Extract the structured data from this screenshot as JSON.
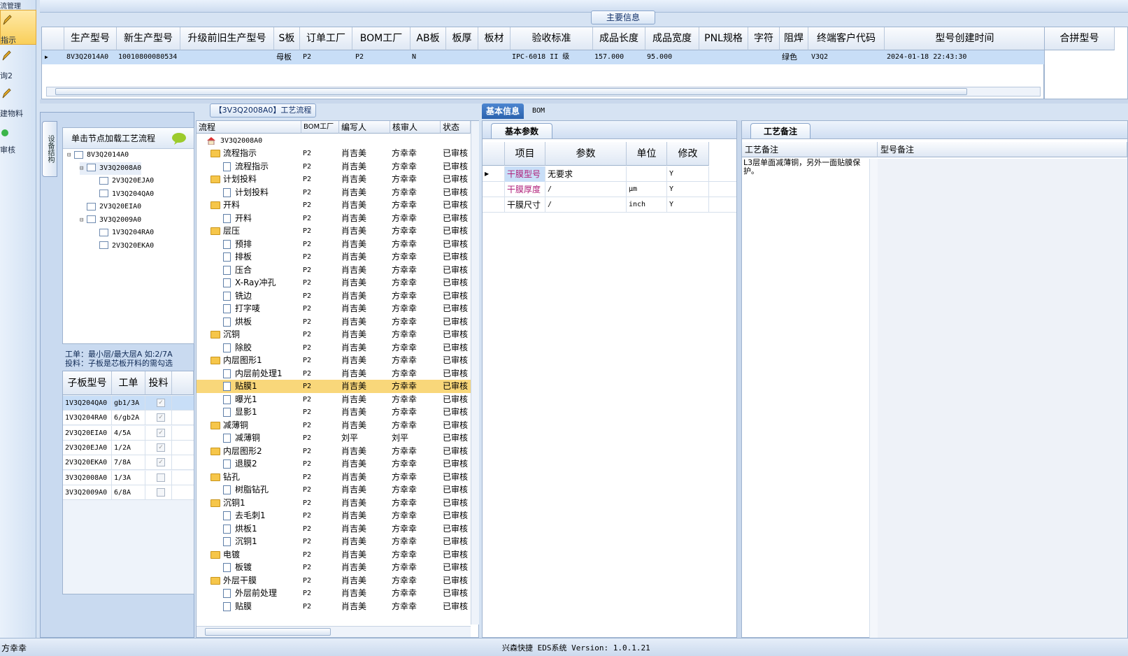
{
  "nav": {
    "items": [
      {
        "label": "指示",
        "active": true
      },
      {
        "label": "询2",
        "active": false
      },
      {
        "label": "建物料",
        "active": false
      },
      {
        "label": "审核",
        "active": false
      }
    ],
    "top_label": "流管理"
  },
  "main_info": {
    "title": "主要信息",
    "columns": [
      "生产型号",
      "新生产型号",
      "升级前旧生产型号",
      "S板",
      "订单工厂",
      "BOM工厂",
      "AB板",
      "板厚",
      "板材",
      "验收标准",
      "成品长度",
      "成品宽度",
      "PNL规格",
      "字符",
      "阻焊",
      "终端客户代码",
      "型号创建时间"
    ],
    "row": {
      "生产型号": "8V3Q2014A0",
      "新生产型号": "10010800080534",
      "升级前旧生产型号": "",
      "S板": "母板",
      "订单工厂": "P2",
      "BOM工厂": "P2",
      "AB板": "N",
      "板厚": "",
      "板材": "",
      "验收标准": "IPC-6018 II 级",
      "成品长度": "157.000",
      "成品宽度": "95.000",
      "PNL规格": "",
      "字符": "",
      "阻焊": "绿色",
      "终端客户代码": "V3Q2",
      "型号创建时间": "2024-01-18 22:43:30"
    },
    "side_header": "合拼型号"
  },
  "structure": {
    "tab_label": "设备结构",
    "hint": "单击节点加载工艺流程",
    "nodes": [
      {
        "id": "8V3Q2014A0",
        "level": 0
      },
      {
        "id": "3V3Q2008A0",
        "level": 1
      },
      {
        "id": "2V3Q20EJA0",
        "level": 2
      },
      {
        "id": "1V3Q204QA0",
        "level": 2
      },
      {
        "id": "2V3Q20EIA0",
        "level": 1
      },
      {
        "id": "3V3Q2009A0",
        "level": 1
      },
      {
        "id": "1V3Q204RA0",
        "level": 2
      },
      {
        "id": "2V3Q20EKA0",
        "level": 2
      }
    ],
    "info_line1": "工单：最小层/最大层A 如:2/7A",
    "info_line2": "投料：子板是芯板开料的需勾选"
  },
  "subboards": {
    "columns": [
      "子板型号",
      "工单",
      "投料"
    ],
    "rows": [
      {
        "model": "1V3Q204QA0",
        "wo": "gb1/3A",
        "checked": true
      },
      {
        "model": "1V3Q204RA0",
        "wo": "6/gb2A",
        "checked": true
      },
      {
        "model": "2V3Q20EIA0",
        "wo": "4/5A",
        "checked": true
      },
      {
        "model": "2V3Q20EJA0",
        "wo": "1/2A",
        "checked": true
      },
      {
        "model": "2V3Q20EKA0",
        "wo": "7/8A",
        "checked": true
      },
      {
        "model": "3V3Q2008A0",
        "wo": "1/3A",
        "checked": false
      },
      {
        "model": "3V3Q2009A0",
        "wo": "6/8A",
        "checked": false
      }
    ]
  },
  "process": {
    "title": "【3V3Q2008A0】工艺流程",
    "columns": [
      "流程",
      "BOM工厂",
      "编写人",
      "核审人",
      "状态"
    ],
    "root": "3V3Q2008A0",
    "rows": [
      {
        "name": "流程指示",
        "type": "folder",
        "bom": "P2",
        "writer": "肖吉美",
        "reviewer": "方幸幸",
        "status": "已审核"
      },
      {
        "name": "流程指示",
        "type": "doc",
        "bom": "P2",
        "writer": "肖吉美",
        "reviewer": "方幸幸",
        "status": "已审核"
      },
      {
        "name": "计划投料",
        "type": "folder",
        "bom": "P2",
        "writer": "肖吉美",
        "reviewer": "方幸幸",
        "status": "已审核"
      },
      {
        "name": "计划投料",
        "type": "doc",
        "bom": "P2",
        "writer": "肖吉美",
        "reviewer": "方幸幸",
        "status": "已审核"
      },
      {
        "name": "开料",
        "type": "folder",
        "bom": "P2",
        "writer": "肖吉美",
        "reviewer": "方幸幸",
        "status": "已审核"
      },
      {
        "name": "开料",
        "type": "doc",
        "bom": "P2",
        "writer": "肖吉美",
        "reviewer": "方幸幸",
        "status": "已审核"
      },
      {
        "name": "层压",
        "type": "folder",
        "bom": "P2",
        "writer": "肖吉美",
        "reviewer": "方幸幸",
        "status": "已审核"
      },
      {
        "name": "预排",
        "type": "doc",
        "bom": "P2",
        "writer": "肖吉美",
        "reviewer": "方幸幸",
        "status": "已审核"
      },
      {
        "name": "排板",
        "type": "doc",
        "bom": "P2",
        "writer": "肖吉美",
        "reviewer": "方幸幸",
        "status": "已审核"
      },
      {
        "name": "压合",
        "type": "doc",
        "bom": "P2",
        "writer": "肖吉美",
        "reviewer": "方幸幸",
        "status": "已审核"
      },
      {
        "name": "X-Ray冲孔",
        "type": "doc",
        "bom": "P2",
        "writer": "肖吉美",
        "reviewer": "方幸幸",
        "status": "已审核"
      },
      {
        "name": "铣边",
        "type": "doc",
        "bom": "P2",
        "writer": "肖吉美",
        "reviewer": "方幸幸",
        "status": "已审核"
      },
      {
        "name": "打字唛",
        "type": "doc",
        "bom": "P2",
        "writer": "肖吉美",
        "reviewer": "方幸幸",
        "status": "已审核"
      },
      {
        "name": "烘板",
        "type": "doc",
        "bom": "P2",
        "writer": "肖吉美",
        "reviewer": "方幸幸",
        "status": "已审核"
      },
      {
        "name": "沉铜",
        "type": "folder",
        "bom": "P2",
        "writer": "肖吉美",
        "reviewer": "方幸幸",
        "status": "已审核"
      },
      {
        "name": "除胶",
        "type": "doc",
        "bom": "P2",
        "writer": "肖吉美",
        "reviewer": "方幸幸",
        "status": "已审核"
      },
      {
        "name": "内层图形1",
        "type": "folder",
        "bom": "P2",
        "writer": "肖吉美",
        "reviewer": "方幸幸",
        "status": "已审核"
      },
      {
        "name": "内层前处理1",
        "type": "doc",
        "bom": "P2",
        "writer": "肖吉美",
        "reviewer": "方幸幸",
        "status": "已审核"
      },
      {
        "name": "贴膜1",
        "type": "doc",
        "bom": "P2",
        "writer": "肖吉美",
        "reviewer": "方幸幸",
        "status": "已审核",
        "selected": true
      },
      {
        "name": "曝光1",
        "type": "doc",
        "bom": "P2",
        "writer": "肖吉美",
        "reviewer": "方幸幸",
        "status": "已审核"
      },
      {
        "name": "显影1",
        "type": "doc",
        "bom": "P2",
        "writer": "肖吉美",
        "reviewer": "方幸幸",
        "status": "已审核"
      },
      {
        "name": "减薄铜",
        "type": "folder",
        "bom": "P2",
        "writer": "肖吉美",
        "reviewer": "方幸幸",
        "status": "已审核"
      },
      {
        "name": "减薄铜",
        "type": "doc",
        "bom": "P2",
        "writer": "刘平",
        "reviewer": "刘平",
        "status": "已审核"
      },
      {
        "name": "内层图形2",
        "type": "folder",
        "bom": "P2",
        "writer": "肖吉美",
        "reviewer": "方幸幸",
        "status": "已审核"
      },
      {
        "name": "退膜2",
        "type": "doc",
        "bom": "P2",
        "writer": "肖吉美",
        "reviewer": "方幸幸",
        "status": "已审核"
      },
      {
        "name": "钻孔",
        "type": "folder",
        "bom": "P2",
        "writer": "肖吉美",
        "reviewer": "方幸幸",
        "status": "已审核"
      },
      {
        "name": "树脂钻孔",
        "type": "doc",
        "bom": "P2",
        "writer": "肖吉美",
        "reviewer": "方幸幸",
        "status": "已审核"
      },
      {
        "name": "沉铜1",
        "type": "folder",
        "bom": "P2",
        "writer": "肖吉美",
        "reviewer": "方幸幸",
        "status": "已审核"
      },
      {
        "name": "去毛刺1",
        "type": "doc",
        "bom": "P2",
        "writer": "肖吉美",
        "reviewer": "方幸幸",
        "status": "已审核"
      },
      {
        "name": "烘板1",
        "type": "doc",
        "bom": "P2",
        "writer": "肖吉美",
        "reviewer": "方幸幸",
        "status": "已审核"
      },
      {
        "name": "沉铜1",
        "type": "doc",
        "bom": "P2",
        "writer": "肖吉美",
        "reviewer": "方幸幸",
        "status": "已审核"
      },
      {
        "name": "电镀",
        "type": "folder",
        "bom": "P2",
        "writer": "肖吉美",
        "reviewer": "方幸幸",
        "status": "已审核"
      },
      {
        "name": "板镀",
        "type": "doc",
        "bom": "P2",
        "writer": "肖吉美",
        "reviewer": "方幸幸",
        "status": "已审核"
      },
      {
        "name": "外层干膜",
        "type": "folder",
        "bom": "P2",
        "writer": "肖吉美",
        "reviewer": "方幸幸",
        "status": "已审核"
      },
      {
        "name": "外层前处理",
        "type": "doc",
        "bom": "P2",
        "writer": "肖吉美",
        "reviewer": "方幸幸",
        "status": "已审核"
      },
      {
        "name": "贴膜",
        "type": "doc",
        "bom": "P2",
        "writer": "肖吉美",
        "reviewer": "方幸幸",
        "status": "已审核"
      }
    ]
  },
  "right": {
    "tabs": [
      "基本信息",
      "BOM"
    ],
    "basic_title": "基本参数",
    "basic_columns": [
      "项目",
      "参数",
      "单位",
      "修改"
    ],
    "basic_rows": [
      {
        "item": "干膜型号",
        "param": "无要求",
        "unit": "",
        "mod": "Y",
        "highlight": true
      },
      {
        "item": "干膜厚度",
        "param": "/",
        "unit": "μm",
        "mod": "Y",
        "highlight": true
      },
      {
        "item": "干膜尺寸",
        "param": "/",
        "unit": "inch",
        "mod": "Y",
        "highlight": false
      }
    ],
    "notes_title": "工艺备注",
    "notes_columns": [
      "工艺备注",
      "型号备注"
    ],
    "craft_note": "L3层单面减薄铜，另外一面贴膜保护。"
  },
  "status": {
    "user": "方幸幸",
    "version": "兴森快捷 EDS系统 Version: 1.0.1.21"
  },
  "colors": {
    "selected_row": "#f9d77a",
    "grid_sel": "#c8def7",
    "accent": "#2b62ae",
    "highlight_text": "#b0207a"
  }
}
